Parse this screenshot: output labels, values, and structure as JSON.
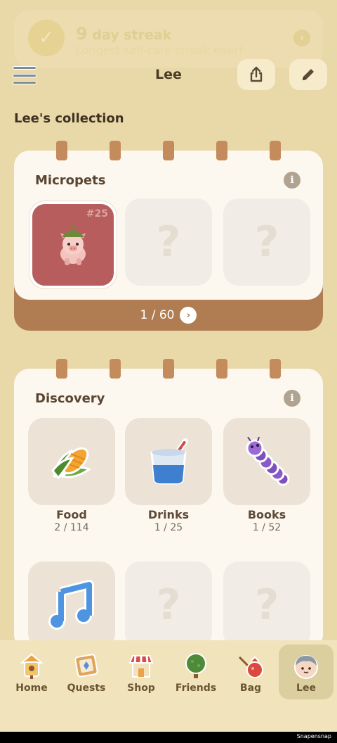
{
  "streak": {
    "count": "9",
    "title_suffix": "day streak",
    "subtitle": "Longest self-care streak ever!"
  },
  "header": {
    "title": "Lee"
  },
  "collection": {
    "title": "Lee's collection"
  },
  "micropets": {
    "heading": "Micropets",
    "pet_number": "#25",
    "locked_symbol": "?",
    "pager": "1 / 60"
  },
  "discovery": {
    "heading": "Discovery",
    "locked_symbol": "?",
    "items": [
      {
        "label": "Food",
        "count": "2 / 114",
        "icon": "corn-icon"
      },
      {
        "label": "Drinks",
        "count": "1 / 25",
        "icon": "drink-cup-icon"
      },
      {
        "label": "Books",
        "count": "1 / 52",
        "icon": "caterpillar-icon"
      },
      {
        "label": "",
        "count": "",
        "icon": "music-note-icon"
      }
    ]
  },
  "nav": {
    "items": [
      {
        "label": "Home",
        "icon": "birdhouse-icon"
      },
      {
        "label": "Quests",
        "icon": "quest-board-icon"
      },
      {
        "label": "Shop",
        "icon": "shop-icon"
      },
      {
        "label": "Friends",
        "icon": "tree-icon"
      },
      {
        "label": "Bag",
        "icon": "bag-icon"
      },
      {
        "label": "Lee",
        "icon": "avatar-icon",
        "active": true
      }
    ]
  },
  "footer": {
    "watermark": "Snapensnap"
  },
  "colors": {
    "background": "#e9d9a9",
    "card": "#fdf8ef",
    "card_base": "#b07d52",
    "pet_tile": "#b85d5d",
    "nav_active": "#dccf9f"
  }
}
